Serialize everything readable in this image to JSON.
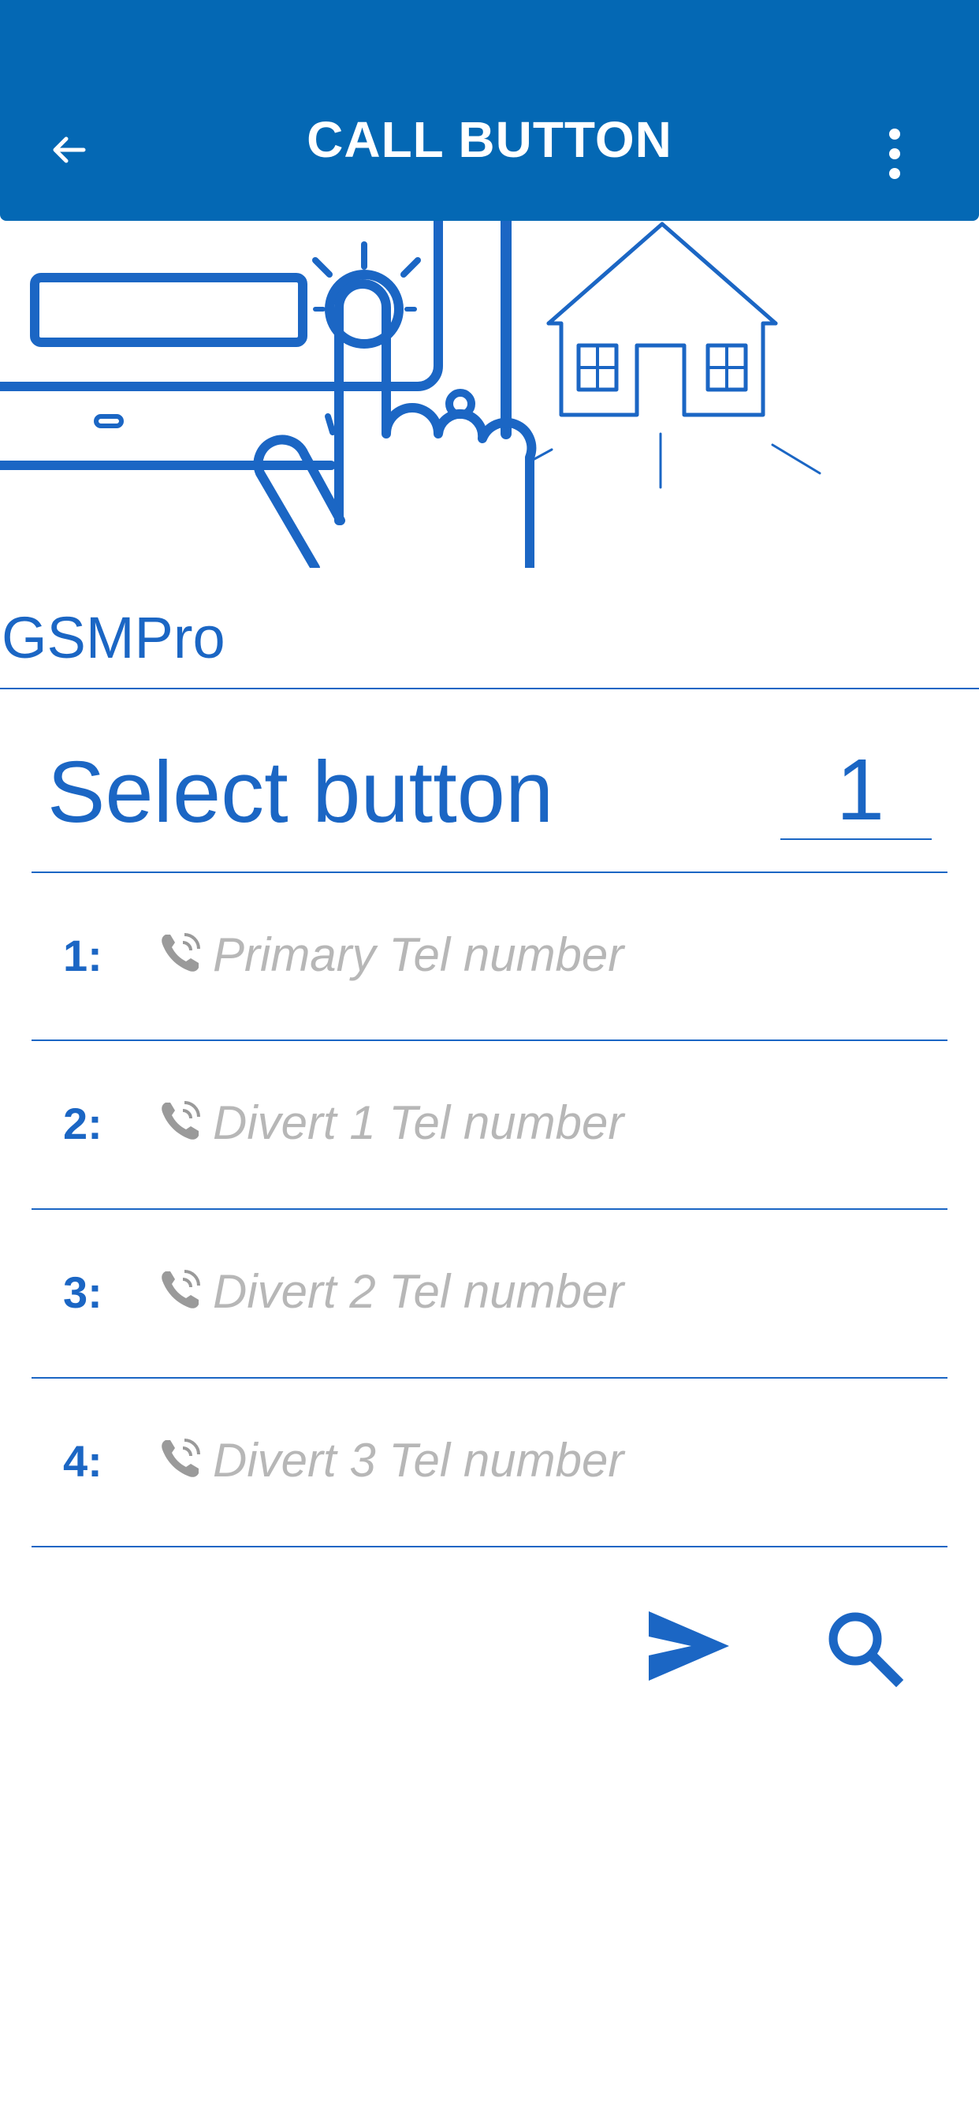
{
  "header": {
    "title": "CALL BUTTON",
    "back_icon": "arrow-left-icon",
    "menu_icon": "more-vertical-icon"
  },
  "brand": {
    "name": "GSMPro"
  },
  "selector": {
    "label": "Select button",
    "value": "1"
  },
  "numbers": [
    {
      "index": "1:",
      "placeholder": "Primary Tel number",
      "value": ""
    },
    {
      "index": "2:",
      "placeholder": "Divert 1 Tel number",
      "value": ""
    },
    {
      "index": "3:",
      "placeholder": "Divert 2 Tel number",
      "value": ""
    },
    {
      "index": "4:",
      "placeholder": "Divert 3 Tel number",
      "value": ""
    }
  ],
  "actions": {
    "send_icon": "send-icon",
    "search_icon": "search-icon"
  },
  "colors": {
    "appbar": "#0468b4",
    "accent": "#1b66c4",
    "placeholder": "#b7b7b7"
  }
}
